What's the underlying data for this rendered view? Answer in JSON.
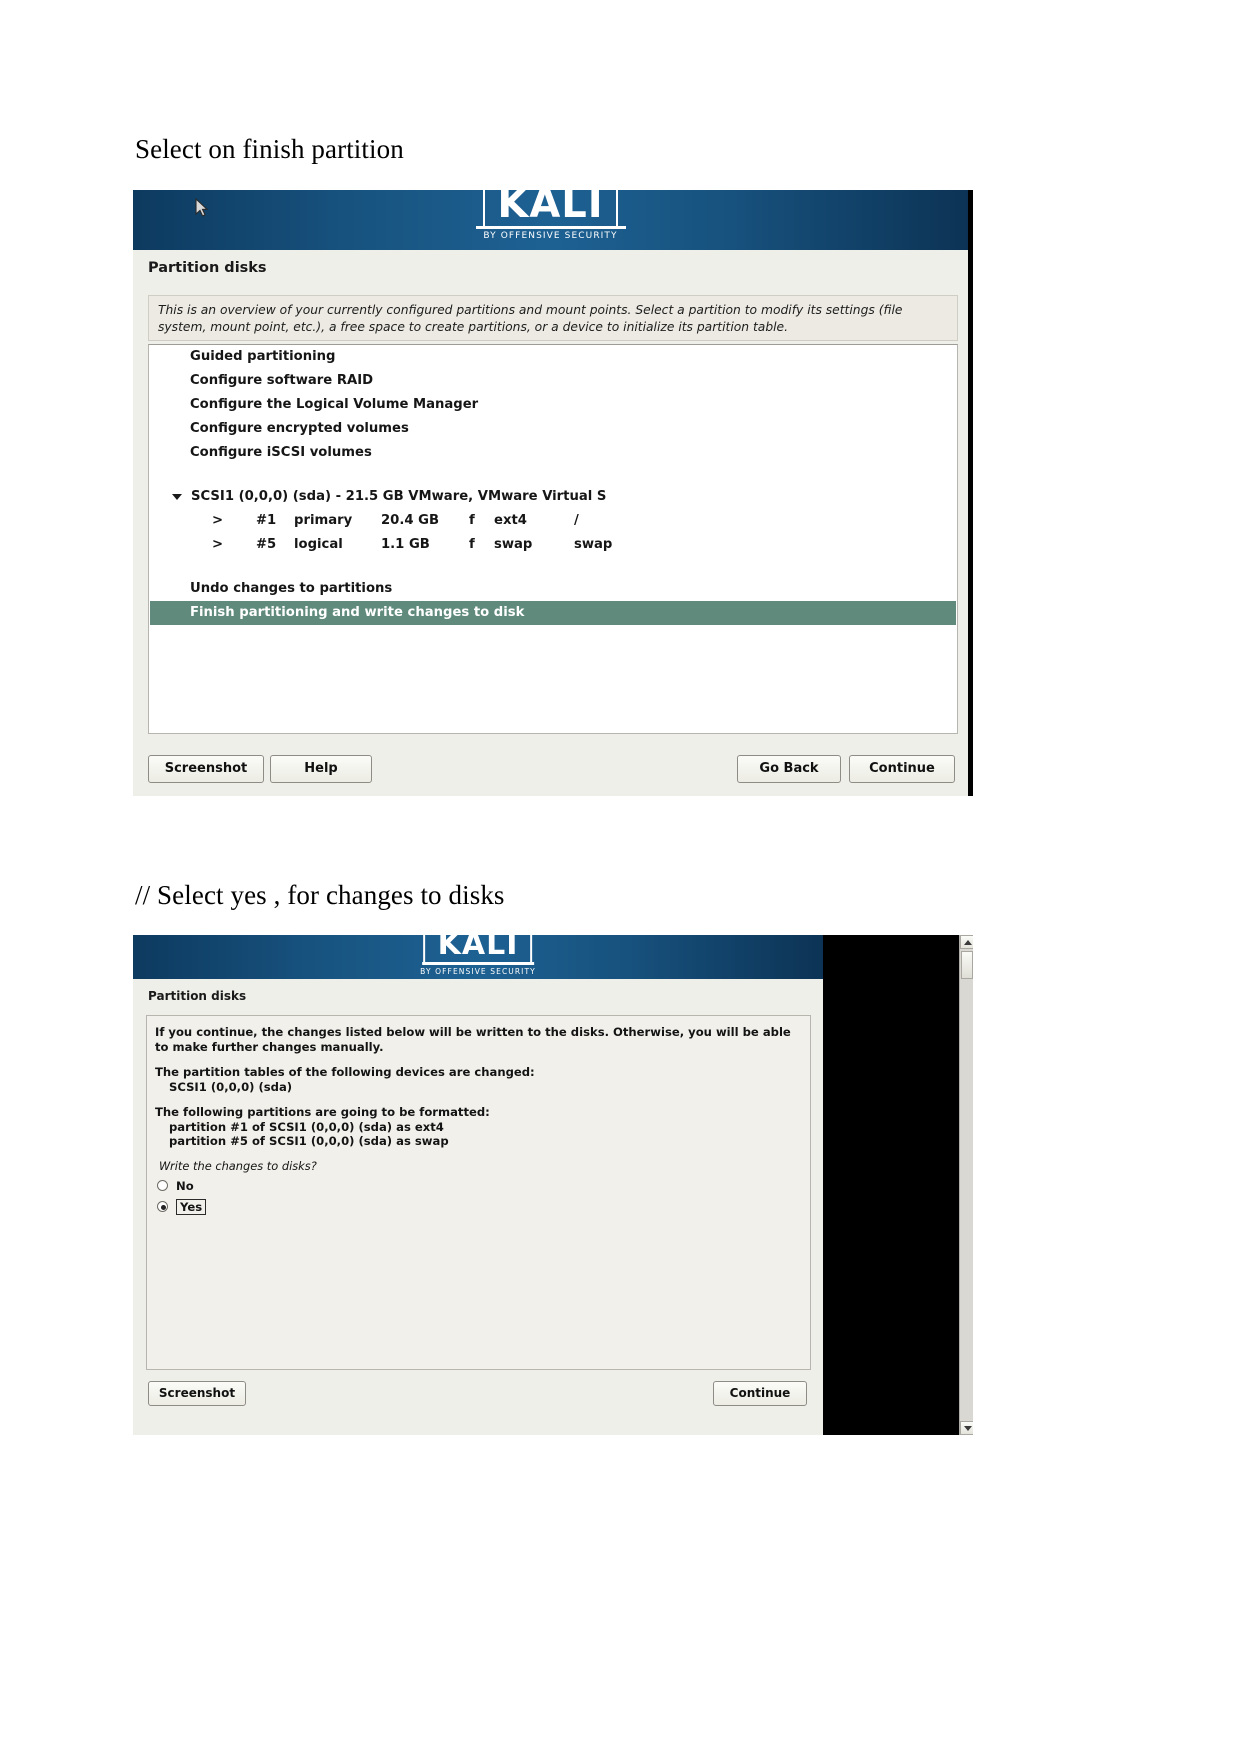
{
  "document": {
    "heading_1": "Select on finish partition",
    "heading_2": "// Select yes , for changes to disks"
  },
  "colors": {
    "banner_blue": "#185481",
    "selection_teal": "#5f8a7c",
    "panel_bg": "#efefea",
    "list_bg": "#ffffff"
  },
  "installer_1": {
    "brand": {
      "word": "KALI",
      "tagline": "BY OFFENSIVE SECURITY"
    },
    "title": "Partition disks",
    "description": "This is an overview of your currently configured partitions and mount points. Select a partition to modify its settings (file system, mount point, etc.), a free space to create partitions, or a device to initialize its partition table.",
    "menu_items": [
      "Guided partitioning",
      "Configure software RAID",
      "Configure the Logical Volume Manager",
      "Configure encrypted volumes",
      "Configure iSCSI volumes"
    ],
    "disk": {
      "label": "SCSI1 (0,0,0) (sda) - 21.5 GB VMware, VMware Virtual S",
      "expanded": true
    },
    "partitions": [
      {
        "marker": ">",
        "number": "#1",
        "type": "primary",
        "size": "20.4 GB",
        "flag": "f",
        "filesystem": "ext4",
        "mountpoint": "/"
      },
      {
        "marker": ">",
        "number": "#5",
        "type": "logical",
        "size": "1.1 GB",
        "flag": "f",
        "filesystem": "swap",
        "mountpoint": "swap"
      }
    ],
    "undo_item": "Undo changes to partitions",
    "selected_item": "Finish partitioning and write changes to disk",
    "buttons": {
      "screenshot": "Screenshot",
      "help": "Help",
      "go_back": "Go Back",
      "continue": "Continue"
    }
  },
  "installer_2": {
    "brand": {
      "word": "KALI",
      "tagline": "BY OFFENSIVE SECURITY"
    },
    "title": "Partition disks",
    "intro": "If you continue, the changes listed below will be written to the disks. Otherwise, you will be able to make further changes manually.",
    "tables_heading": "The partition tables of the following devices are changed:",
    "tables_device": "SCSI1 (0,0,0) (sda)",
    "format_heading": "The following partitions are going to be formatted:",
    "format_items": [
      "partition #1 of SCSI1 (0,0,0) (sda) as ext4",
      "partition #5 of SCSI1 (0,0,0) (sda) as swap"
    ],
    "question": "Write the changes to disks?",
    "options": [
      {
        "label": "No",
        "selected": false
      },
      {
        "label": "Yes",
        "selected": true
      }
    ],
    "buttons": {
      "screenshot": "Screenshot",
      "continue": "Continue"
    }
  }
}
